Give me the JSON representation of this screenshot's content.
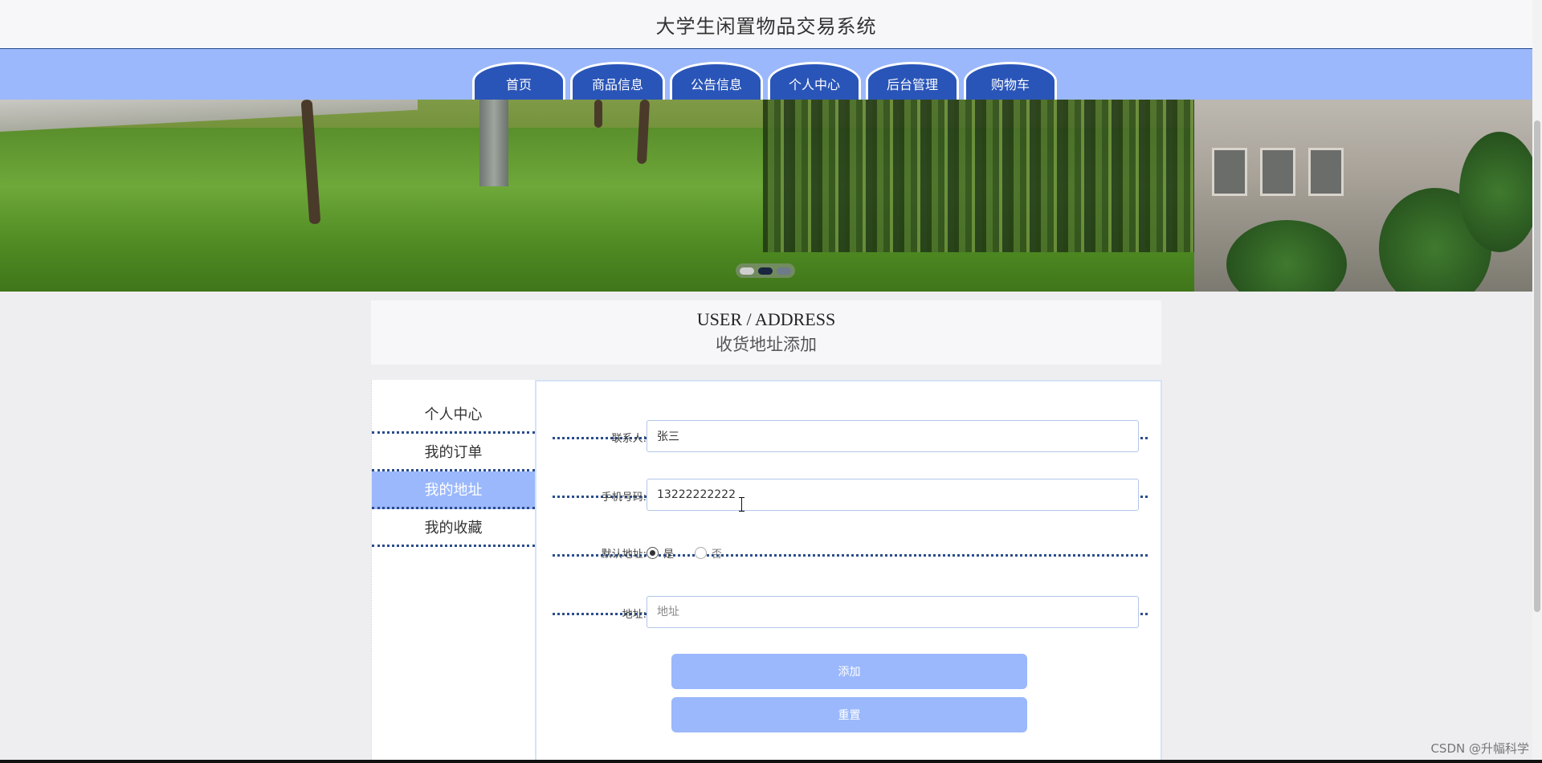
{
  "header": {
    "title": "大学生闲置物品交易系统"
  },
  "nav": {
    "tabs": [
      {
        "label": "首页"
      },
      {
        "label": "商品信息"
      },
      {
        "label": "公告信息"
      },
      {
        "label": "个人中心"
      },
      {
        "label": "后台管理"
      },
      {
        "label": "购物车"
      }
    ]
  },
  "banner": {
    "active_slide": 2,
    "slide_count": 3
  },
  "section": {
    "title_en": "USER / ADDRESS",
    "title_cn": "收货地址添加"
  },
  "sidebar": {
    "items": [
      {
        "label": "个人中心",
        "active": false
      },
      {
        "label": "我的订单",
        "active": false
      },
      {
        "label": "我的地址",
        "active": true
      },
      {
        "label": "我的收藏",
        "active": false
      }
    ]
  },
  "form": {
    "contact": {
      "label": "联系人:",
      "value": "张三"
    },
    "phone": {
      "label": "手机号码:",
      "value": "13222222222"
    },
    "default": {
      "label": "默认地址:",
      "options": [
        "是",
        "否"
      ],
      "selected": "是"
    },
    "address": {
      "label": "地址:",
      "value": "",
      "placeholder": "地址"
    },
    "add_button": "添加",
    "reset_button": "重置"
  },
  "watermark": "CSDN @升幅科学",
  "colors": {
    "accent": "#9bb8fc",
    "nav_tab": "#2a55b8",
    "divider": "#2a4c8c"
  }
}
